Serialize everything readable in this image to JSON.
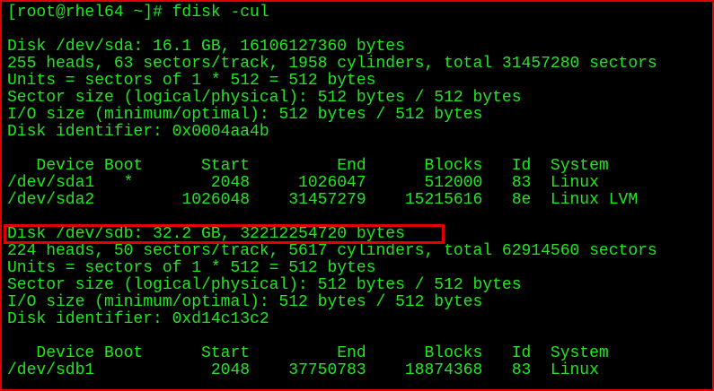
{
  "terminal": {
    "prompt": "[root@rhel64 ~]# fdisk -cul",
    "lines": [
      "",
      "Disk /dev/sda: 16.1 GB, 16106127360 bytes",
      "255 heads, 63 sectors/track, 1958 cylinders, total 31457280 sectors",
      "Units = sectors of 1 * 512 = 512 bytes",
      "Sector size (logical/physical): 512 bytes / 512 bytes",
      "I/O size (minimum/optimal): 512 bytes / 512 bytes",
      "Disk identifier: 0x0004aa4b",
      "",
      "   Device Boot      Start         End      Blocks   Id  System",
      "/dev/sda1   *        2048     1026047      512000   83  Linux",
      "/dev/sda2         1026048    31457279    15215616   8e  Linux LVM",
      "",
      "Disk /dev/sdb: 32.2 GB, 32212254720 bytes",
      "224 heads, 50 sectors/track, 5617 cylinders, total 62914560 sectors",
      "Units = sectors of 1 * 512 = 512 bytes",
      "Sector size (logical/physical): 512 bytes / 512 bytes",
      "I/O size (minimum/optimal): 512 bytes / 512 bytes",
      "Disk identifier: 0xd14c13c2",
      "",
      "   Device Boot      Start         End      Blocks   Id  System",
      "/dev/sdb1            2048    37750783    18874368   83  Linux"
    ]
  },
  "colors": {
    "text": "#22e622",
    "highlight": "#e00000",
    "background": "#000000"
  }
}
